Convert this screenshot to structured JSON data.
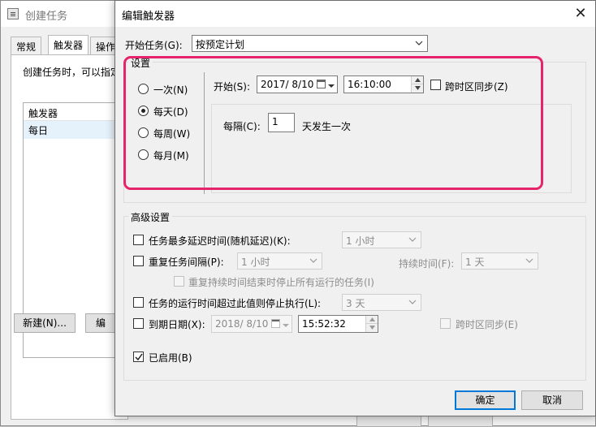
{
  "background_window": {
    "title": "创建任务",
    "tabs": [
      "常规",
      "触发器",
      "操作"
    ],
    "description": "创建任务时，可以指定",
    "list_header": "触发器",
    "list_row": "每日",
    "new_button": "新建(N)...",
    "edit_button": "编"
  },
  "dialog": {
    "title": "编辑触发器",
    "close_label": "✕",
    "begin_task_label": "开始任务(G):",
    "begin_task_value": "按预定计划",
    "settings_group_label": "设置",
    "schedule_options": [
      {
        "label": "一次(N)",
        "checked": false
      },
      {
        "label": "每天(D)",
        "checked": true
      },
      {
        "label": "每周(W)",
        "checked": false
      },
      {
        "label": "每月(M)",
        "checked": false
      }
    ],
    "start_label": "开始(S):",
    "start_date": "2017/  8/10",
    "start_time": "16:10:00",
    "sync_timezone_label": "跨时区同步(Z)",
    "recur_label": "每隔(C):",
    "recur_value": "1",
    "recur_suffix": "天发生一次",
    "advanced_group_label": "高级设置",
    "delay_label": "任务最多延迟时间(随机延迟)(K):",
    "delay_value": "1 小时",
    "repeat_label": "重复任务间隔(P):",
    "repeat_value": "1 小时",
    "duration_label": "持续时间(F):",
    "duration_value": "1 天",
    "stop_running_label": "重复持续时间结束时停止所有运行的任务(I)",
    "stop_if_longer_label": "任务的运行时间超过此值则停止执行(L):",
    "stop_if_longer_value": "3 天",
    "expire_label": "到期日期(X):",
    "expire_date": "2018/  8/10",
    "expire_time": "15:52:32",
    "expire_sync_label": "跨时区同步(E)",
    "enabled_label": "已启用(B)",
    "enabled_checked": true,
    "ok_button": "确定",
    "cancel_button": "取消"
  },
  "colors": {
    "highlight": "#e6246b",
    "accent": "#0078d7"
  }
}
